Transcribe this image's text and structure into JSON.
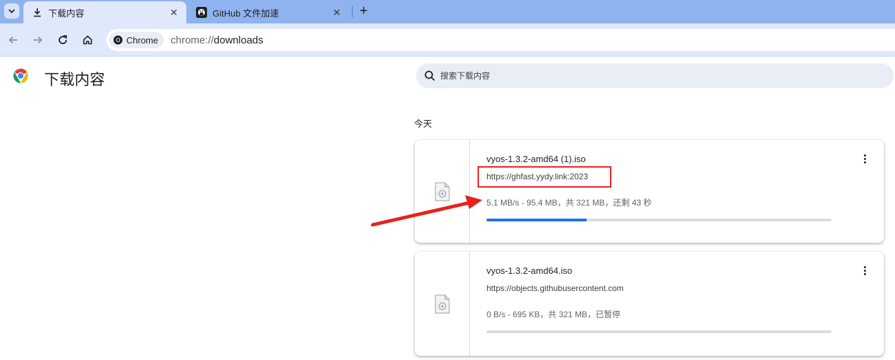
{
  "browser": {
    "tabs": [
      {
        "title": "下载内容",
        "icon": "download-icon",
        "active": true
      },
      {
        "title": "GitHub 文件加速",
        "icon": "github-icon",
        "active": false
      }
    ],
    "new_tab_label": "+",
    "omnibox": {
      "chip_label": "Chrome",
      "url_scheme": "chrome://",
      "url_rest": "downloads"
    }
  },
  "page": {
    "title": "下载内容",
    "search_placeholder": "搜索下载内容",
    "section_label": "今天"
  },
  "downloads": [
    {
      "name": "vyos-1.3.2-amd64 (1).iso",
      "source": "https://ghfast.yydy.link:2023",
      "status": "5.1 MB/s - 95.4 MB，共 321 MB，还剩 43 秒",
      "progress": 0.29,
      "highlighted": true
    },
    {
      "name": "vyos-1.3.2-amd64.iso",
      "source": "https://objects.githubusercontent.com",
      "status": "0 B/s - 695 KB，共 321 MB，已暂停",
      "progress": 0.0,
      "highlighted": false
    }
  ],
  "colors": {
    "tabstrip": "#8fb3ee",
    "toolbar": "#dfe9fb",
    "progress_fill": "#1a73e8",
    "annotation": "#e8211a"
  }
}
